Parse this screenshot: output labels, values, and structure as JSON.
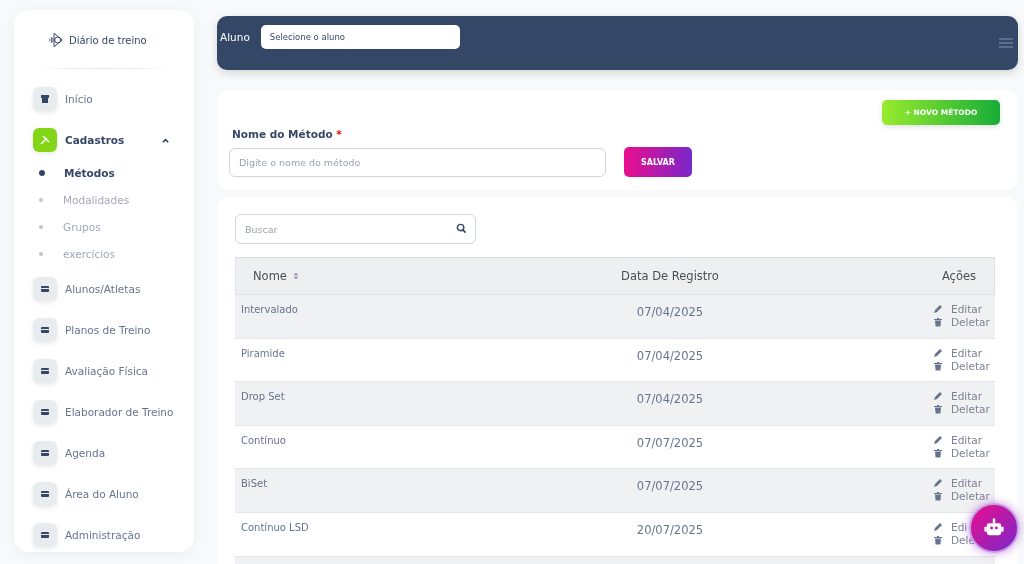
{
  "brand": "Diário de treino",
  "sidebar": {
    "items": [
      {
        "label": "Início",
        "kind": "home",
        "selected": false
      },
      {
        "label": "Cadastros",
        "kind": "tools",
        "selected": true,
        "expanded": true,
        "children": [
          {
            "label": "Métodos",
            "selected": true
          },
          {
            "label": "Modalidades",
            "selected": false
          },
          {
            "label": "Grupos",
            "selected": false
          },
          {
            "label": "exercícios",
            "selected": false
          }
        ]
      },
      {
        "label": "Alunos/Atletas",
        "kind": "card",
        "selected": false
      },
      {
        "label": "Planos de Treino",
        "kind": "card",
        "selected": false
      },
      {
        "label": "Avaliação Física",
        "kind": "card",
        "selected": false
      },
      {
        "label": "Elaborador de Treino",
        "kind": "card",
        "selected": false
      },
      {
        "label": "Agenda",
        "kind": "card",
        "selected": false
      },
      {
        "label": "Área do Aluno",
        "kind": "card",
        "selected": false
      },
      {
        "label": "Administração",
        "kind": "card",
        "selected": false
      }
    ]
  },
  "topbar": {
    "label": "Aluno",
    "select": "Selecione o aluno"
  },
  "form": {
    "new_button": "+ NOVO MÉTODO",
    "label": "Nome do Método",
    "required": "*",
    "placeholder": "Digite o nome do método",
    "save_button": "SALVAR"
  },
  "search": {
    "placeholder": "Buscar"
  },
  "table": {
    "columns": [
      "Nome",
      "Data De Registro",
      "Ações"
    ],
    "rows": [
      {
        "name": "Intervalado",
        "date": "07/04/2025",
        "edit": "Editar",
        "delete": "Deletar"
      },
      {
        "name": "Piramide",
        "date": "07/04/2025",
        "edit": "Editar",
        "delete": "Deletar"
      },
      {
        "name": "Drop Set",
        "date": "07/04/2025",
        "edit": "Editar",
        "delete": "Deletar"
      },
      {
        "name": "Contínuo",
        "date": "07/07/2025",
        "edit": "Editar",
        "delete": "Deletar"
      },
      {
        "name": "BiSet",
        "date": "07/07/2025",
        "edit": "Editar",
        "delete": "Deletar"
      },
      {
        "name": "Contínuo LSD",
        "date": "20/07/2025",
        "edit": "Edi",
        "delete": "Dele"
      }
    ]
  }
}
